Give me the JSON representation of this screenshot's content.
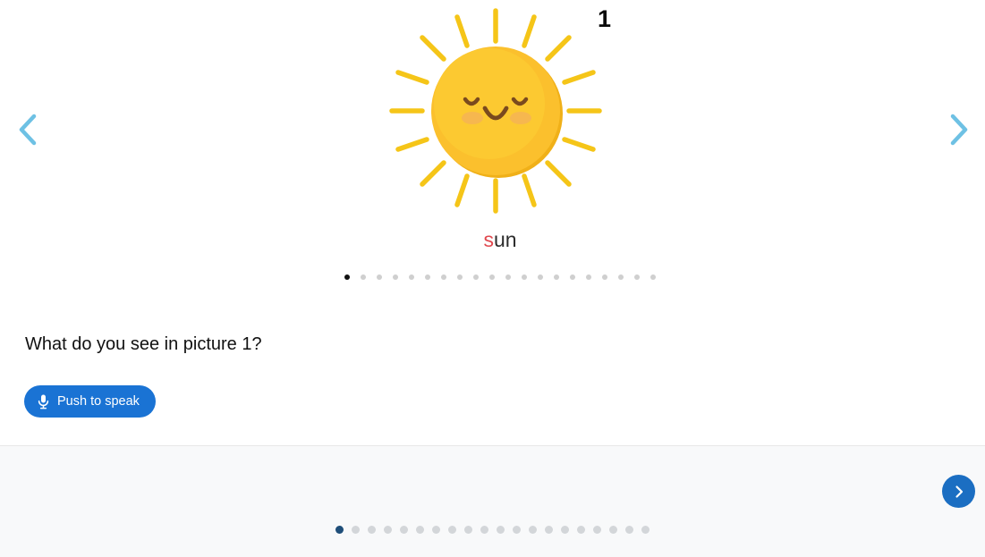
{
  "slide": {
    "number": "1",
    "caption_highlight": "s",
    "caption_rest": "un",
    "caption_full": "sun",
    "image_name": "sun-illustration",
    "colors": {
      "sun_body": "#FBC02D",
      "sun_body_light": "#FDD13A",
      "sun_shadow": "#F0B018",
      "rays": "#F5C518",
      "face": "#7A4A1E",
      "cheeks": "#F0A868",
      "caption_highlight": "#e0484e",
      "caption_rest": "#2c2c2c"
    }
  },
  "nav": {
    "prev_label": "Previous picture",
    "prev_icon": "chevron-left-icon",
    "next_label": "Next picture",
    "next_icon": "chevron-right-icon",
    "arrow_color": "#6ec1e4"
  },
  "pagination_top": {
    "total": 20,
    "active_index": 0,
    "active_color": "#111111",
    "inactive_color": "#cfcfcf"
  },
  "question": {
    "text": "What do you see in picture 1?"
  },
  "speak": {
    "label": "Push to speak",
    "icon": "microphone-icon",
    "background": "#1a73d4",
    "text_color": "#ffffff"
  },
  "footer": {
    "background": "#f8f9fa",
    "next_button_label": "Next",
    "next_button_icon": "chevron-right-icon",
    "next_button_color": "#1b6ec2",
    "pagination": {
      "total": 20,
      "active_index": 0,
      "active_color": "#1f4e79",
      "inactive_color": "#d3d6d9"
    }
  }
}
